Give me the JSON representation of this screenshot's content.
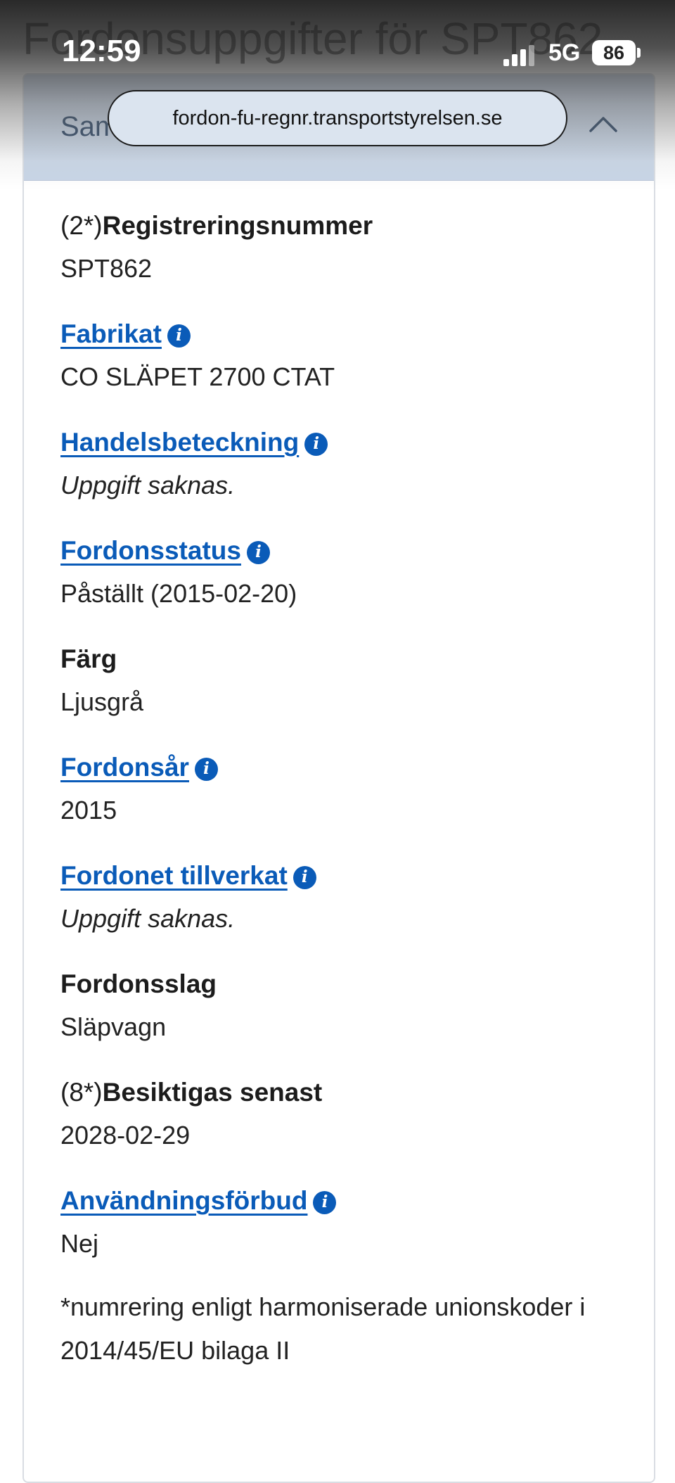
{
  "status_bar": {
    "time": "12:59",
    "network": "5G",
    "battery": "86"
  },
  "browser": {
    "url": "fordon-fu-regnr.transportstyrelsen.se"
  },
  "page": {
    "title": "Fordonsuppgifter för SPT862"
  },
  "section": {
    "title": "Sammanfattning",
    "expanded": true
  },
  "fields": [
    {
      "prefix": "(2*)",
      "label": "Registreringsnummer",
      "value": "SPT862",
      "link": false,
      "missing": false
    },
    {
      "prefix": "",
      "label": "Fabrikat",
      "value": "CO SLÄPET 2700 CTAT",
      "link": true,
      "missing": false
    },
    {
      "prefix": "",
      "label": "Handelsbeteckning",
      "value": "Uppgift saknas.",
      "link": true,
      "missing": true
    },
    {
      "prefix": "",
      "label": "Fordonsstatus",
      "value": "Påställt (2015-02-20)",
      "link": true,
      "missing": false
    },
    {
      "prefix": "",
      "label": "Färg",
      "value": "Ljusgrå",
      "link": false,
      "missing": false
    },
    {
      "prefix": "",
      "label": "Fordonsår",
      "value": "2015",
      "link": true,
      "missing": false
    },
    {
      "prefix": "",
      "label": "Fordonet tillverkat",
      "value": "Uppgift saknas.",
      "link": true,
      "missing": true
    },
    {
      "prefix": "",
      "label": "Fordonsslag",
      "value": "Släpvagn",
      "link": false,
      "missing": false
    },
    {
      "prefix": "(8*)",
      "label": "Besiktigas senast",
      "value": "2028-02-29",
      "link": false,
      "missing": false
    },
    {
      "prefix": "",
      "label": "Användningsförbud",
      "value": "Nej",
      "link": true,
      "missing": false
    }
  ],
  "info_icon_glyph": "i",
  "footnote": "*numrering enligt harmoniserade unionskoder i 2014/45/EU bilaga II",
  "colors": {
    "link": "#0a5bb8",
    "header_bg": "#c7d5e7",
    "header_text": "#1f3a5c"
  }
}
